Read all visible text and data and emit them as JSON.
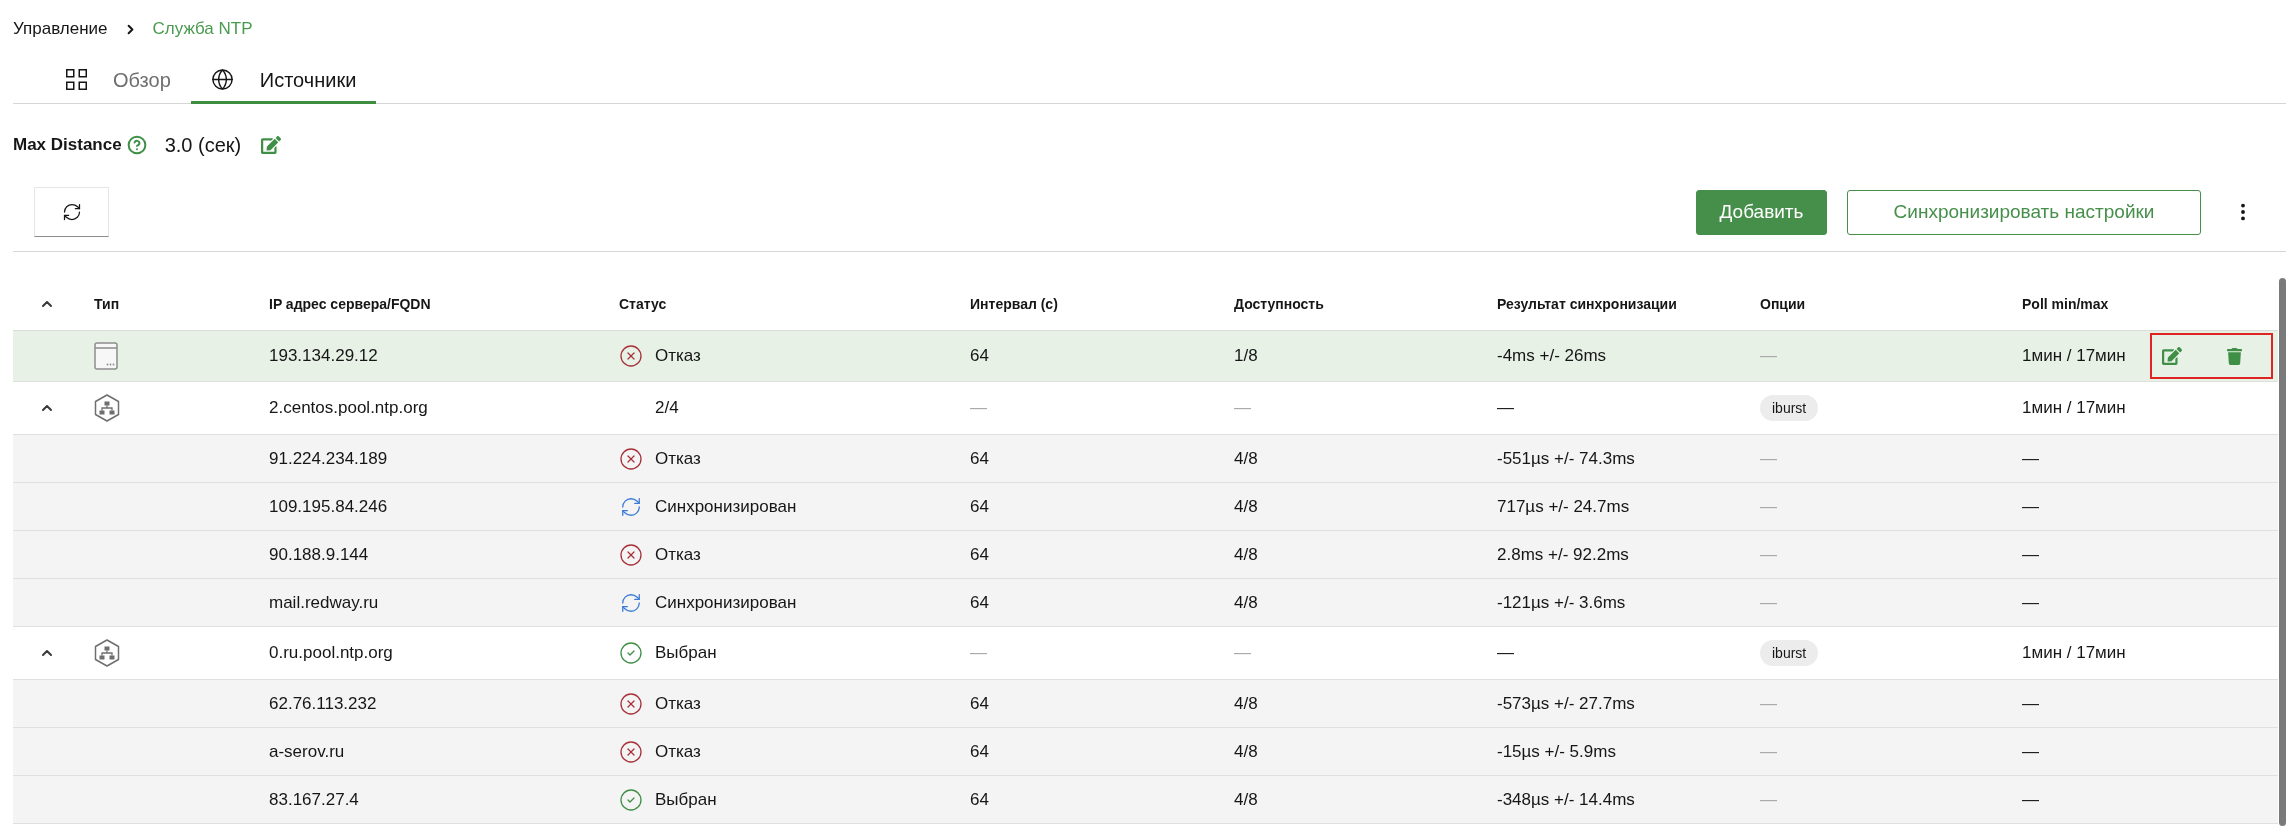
{
  "breadcrumb": [
    {
      "label": "Управление",
      "current": false
    },
    {
      "label": "Служба NTP",
      "current": true
    }
  ],
  "tabs": [
    {
      "kind": "overview",
      "label": "Обзор",
      "selected": false
    },
    {
      "kind": "sources",
      "label": "Источники",
      "selected": true
    }
  ],
  "max_distance": {
    "label": "Max Distance",
    "value": "3.0 (сек)"
  },
  "toolbar": {
    "buttons": [
      {
        "kind": "primary",
        "label": "Добавить"
      },
      {
        "kind": "secondary",
        "label": "Синхронизировать настройки"
      }
    ]
  },
  "table": {
    "expanded": true,
    "action_frame": true,
    "columns": [
      "Тип",
      "IP адрес сервера/FQDN",
      "Статус",
      "Интервал (с)",
      "Доступность",
      "Результат синхронизации",
      "Опции",
      "Poll min/max"
    ],
    "rows": [
      {
        "kind": "server",
        "selected": true,
        "address": "193.134.29.12",
        "status": {
          "kind": "failed",
          "text": "Отказ"
        },
        "interval": "64",
        "availability": "1/8",
        "result": "-4ms +/- 26ms",
        "options": {
          "kind": "none",
          "text": "—"
        },
        "poll": "1мин / 17мин"
      },
      {
        "kind": "pool",
        "selected": false,
        "expanded": true,
        "address": "2.centos.pool.ntp.org",
        "status": {
          "kind": "plain",
          "text": "2/4"
        },
        "interval": "—",
        "availability": "—",
        "result": "—",
        "options": {
          "kind": "tag",
          "text": "iburst"
        },
        "poll": "1мин / 17мин",
        "children": [
          {
            "selected": false,
            "address": "91.224.234.189",
            "status": {
              "kind": "failed",
              "text": "Отказ"
            },
            "interval": "64",
            "availability": "4/8",
            "result": "-551µs +/- 74.3ms",
            "options": {
              "kind": "none",
              "text": "—"
            },
            "poll": "—"
          },
          {
            "selected": false,
            "address": "109.195.84.246",
            "status": {
              "kind": "synced",
              "text": "Синхронизирован"
            },
            "interval": "64",
            "availability": "4/8",
            "result": "717µs +/- 24.7ms",
            "options": {
              "kind": "none",
              "text": "—"
            },
            "poll": "—"
          },
          {
            "selected": false,
            "address": "90.188.9.144",
            "status": {
              "kind": "failed",
              "text": "Отказ"
            },
            "interval": "64",
            "availability": "4/8",
            "result": "2.8ms +/- 92.2ms",
            "options": {
              "kind": "none",
              "text": "—"
            },
            "poll": "—"
          },
          {
            "selected": false,
            "address": "mail.redway.ru",
            "status": {
              "kind": "synced",
              "text": "Синхронизирован"
            },
            "interval": "64",
            "availability": "4/8",
            "result": "-121µs +/- 3.6ms",
            "options": {
              "kind": "none",
              "text": "—"
            },
            "poll": "—"
          }
        ]
      },
      {
        "kind": "pool",
        "selected": false,
        "expanded": true,
        "address": "0.ru.pool.ntp.org",
        "status": {
          "kind": "chosen",
          "text": "Выбран"
        },
        "interval": "—",
        "availability": "—",
        "result": "—",
        "options": {
          "kind": "tag",
          "text": "iburst"
        },
        "poll": "1мин / 17мин",
        "children": [
          {
            "selected": false,
            "address": "62.76.113.232",
            "status": {
              "kind": "failed",
              "text": "Отказ"
            },
            "interval": "64",
            "availability": "4/8",
            "result": "-573µs +/- 27.7ms",
            "options": {
              "kind": "none",
              "text": "—"
            },
            "poll": "—"
          },
          {
            "selected": false,
            "address": "a-serov.ru",
            "status": {
              "kind": "failed",
              "text": "Отказ"
            },
            "interval": "64",
            "availability": "4/8",
            "result": "-15µs +/- 5.9ms",
            "options": {
              "kind": "none",
              "text": "—"
            },
            "poll": "—"
          },
          {
            "selected": false,
            "address": "83.167.27.4",
            "status": {
              "kind": "chosen",
              "text": "Выбран"
            },
            "interval": "64",
            "availability": "4/8",
            "result": "-348µs +/- 14.4ms",
            "options": {
              "kind": "none",
              "text": "—"
            },
            "poll": "—"
          }
        ]
      }
    ]
  }
}
